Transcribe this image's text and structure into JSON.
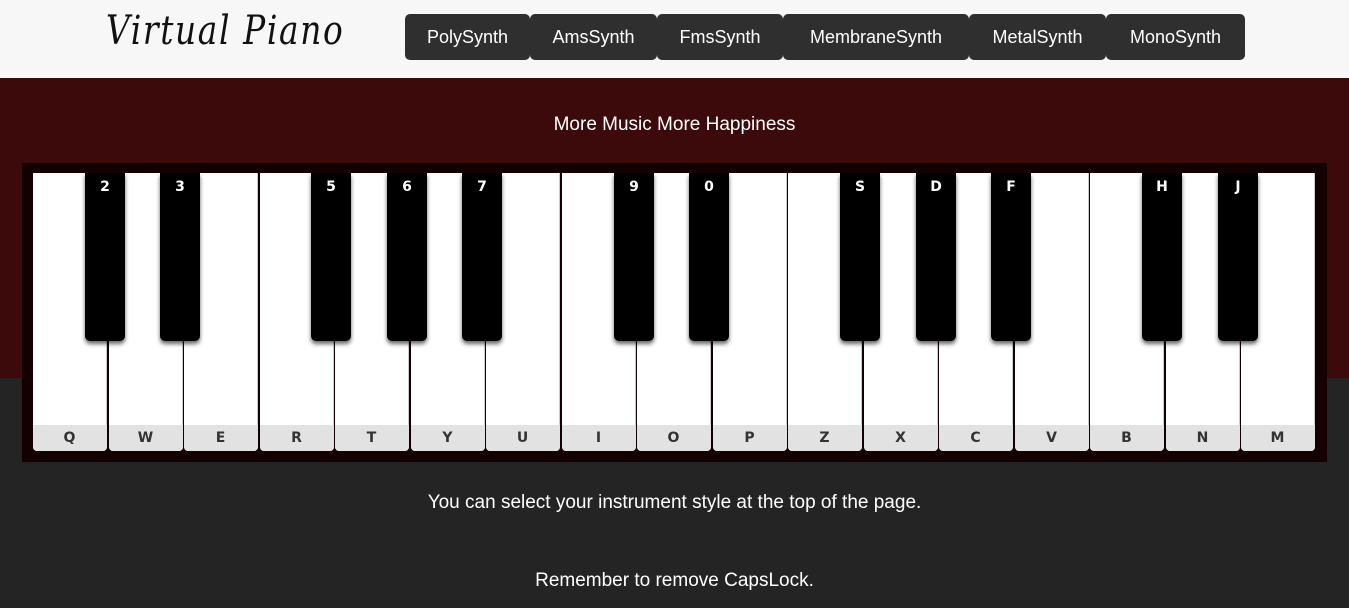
{
  "header": {
    "logo": "Virtual Piano",
    "synths": [
      "PolySynth",
      "AmsSynth",
      "FmsSynth",
      "MembraneSynth",
      "MetalSynth",
      "MonoSynth"
    ]
  },
  "tagline": "More Music More Happiness",
  "piano": {
    "white_keys": [
      "Q",
      "W",
      "E",
      "R",
      "T",
      "Y",
      "U",
      "I",
      "O",
      "P",
      "Z",
      "X",
      "C",
      "V",
      "B",
      "N",
      "M"
    ],
    "black_keys": [
      "2",
      "3",
      "5",
      "6",
      "7",
      "9",
      "0",
      "S",
      "D",
      "F",
      "H",
      "J"
    ]
  },
  "info": {
    "line1": "You can select your instrument style at the top of the page.",
    "line2": "Remember to remove CapsLock."
  },
  "colors": {
    "header_bg": "#f7f7f7",
    "button_bg": "#2f2f2f",
    "hero_bg": "#3c0a0b",
    "page_bg": "#242424",
    "key_label_bg": "#e2e2e2"
  }
}
